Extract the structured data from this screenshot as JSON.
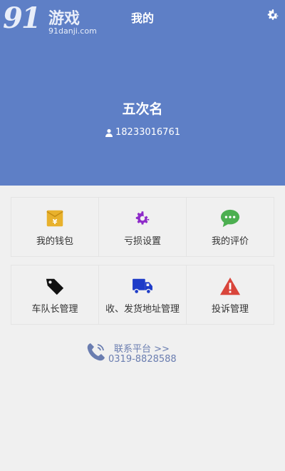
{
  "watermark": {
    "logo_text": "91",
    "logo_cn": "游戏",
    "url": "91danji.com"
  },
  "header": {
    "title": "我的"
  },
  "user": {
    "name": "五次名",
    "phone": "18233016761"
  },
  "menu": {
    "row1": [
      {
        "label": "我的钱包",
        "icon": "wallet-icon",
        "color": "#e8b12c"
      },
      {
        "label": "亏损设置",
        "icon": "gear-icon",
        "color": "#8e2bc9"
      },
      {
        "label": "我的评价",
        "icon": "chat-icon",
        "color": "#4caf50"
      }
    ],
    "row2": [
      {
        "label": "车队长管理",
        "icon": "tag-icon",
        "color": "#111111"
      },
      {
        "label": "收、发货地址管理",
        "icon": "truck-icon",
        "color": "#1e3cc8"
      },
      {
        "label": "投诉管理",
        "icon": "warning-icon",
        "color": "#d9453b"
      }
    ]
  },
  "contact": {
    "label": "联系平台 >>",
    "number": "0319-8828588"
  },
  "colors": {
    "header_bg": "#5e7fc6",
    "page_bg": "#f0f0f0",
    "contact_text": "#6a7db0"
  }
}
